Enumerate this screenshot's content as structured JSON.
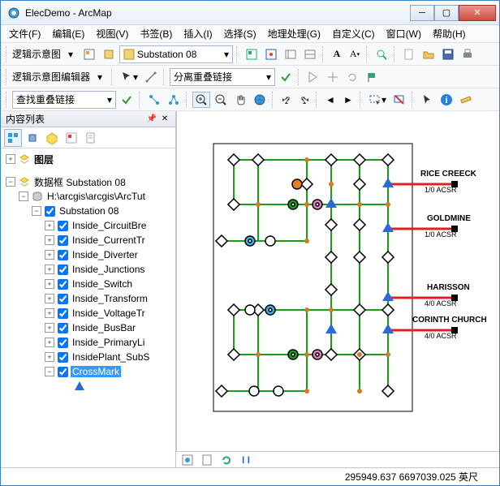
{
  "window": {
    "title": "ElecDemo - ArcMap"
  },
  "menu": {
    "file": "文件(F)",
    "edit": "编辑(E)",
    "view": "视图(V)",
    "bookmarks": "书签(B)",
    "insert": "插入(I)",
    "select": "选择(S)",
    "geoprocessing": "地理处理(G)",
    "customize": "自定义(C)",
    "window": "窗口(W)",
    "help": "帮助(H)"
  },
  "toolbar1": {
    "schematic_label": "逻辑示意图",
    "substation_combo": "Substation 08"
  },
  "toolbar2": {
    "editor_label": "逻辑示意图编辑器",
    "combo2": "分离重叠链接"
  },
  "toolbar3": {
    "find_combo": "查找重叠链接"
  },
  "toc": {
    "title": "内容列表",
    "root": "图层",
    "dataframe_prefix": "数据框",
    "dataframe_name": "Substation 08",
    "gdb_path": "H:\\arcgis\\arcgis\\ArcTut",
    "feature_dataset": "Substation 08",
    "layers": [
      "Inside_CircuitBre",
      "Inside_CurrentTr",
      "Inside_Diverter",
      "Inside_Junctions",
      "Inside_Switch",
      "Inside_Transform",
      "Inside_VoltageTr",
      "Inside_BusBar",
      "Inside_PrimaryLi",
      "InsidePlant_SubS",
      "CrossMark"
    ],
    "selected_index": 10
  },
  "map": {
    "feeders": [
      {
        "name": "RICE CREECK",
        "sub": "1/0 ACSR"
      },
      {
        "name": "GOLDMINE",
        "sub": "1/0 ACSR"
      },
      {
        "name": "HARISSON",
        "sub": "4/0 ACSR"
      },
      {
        "name": "CORINTH CHURCH",
        "sub": "4/0 ACSR"
      }
    ]
  },
  "status": {
    "coords": "295949.637  6697039.025 英尺"
  }
}
